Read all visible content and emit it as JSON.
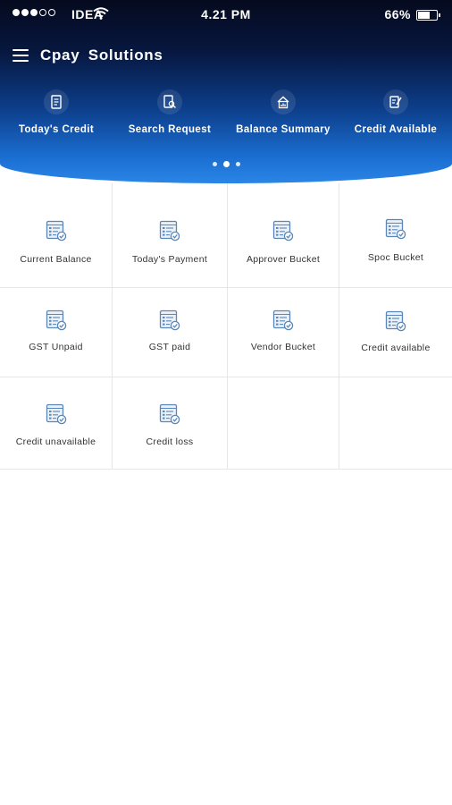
{
  "status_bar": {
    "carrier": "IDEA",
    "time": "4.21 PM",
    "battery_percent": "66%",
    "battery_level": 0.66
  },
  "app_bar": {
    "title": "Cpay  Solutions"
  },
  "quick_actions": [
    {
      "label": "Today's Credit",
      "icon": "document-icon"
    },
    {
      "label": "Search Request",
      "icon": "search-document-icon"
    },
    {
      "label": "Balance Summary",
      "icon": "home-chart-icon"
    },
    {
      "label": "Credit Available",
      "icon": "document-pen-icon"
    }
  ],
  "pager": {
    "pages": 3,
    "active": 1
  },
  "tiles": [
    {
      "label": "Current Balance"
    },
    {
      "label": "Today's Payment"
    },
    {
      "label": "Approver Bucket"
    },
    {
      "label": "Spoc Bucket"
    },
    {
      "label": "GST Unpaid"
    },
    {
      "label": "GST paid"
    },
    {
      "label": "Vendor Bucket"
    },
    {
      "label": "Credit available"
    },
    {
      "label": "Credit unavailable"
    },
    {
      "label": "Credit loss"
    }
  ],
  "colors": {
    "header_top": "#050a1e",
    "header_bottom": "#2a86e6",
    "icon_accent": "#5a87b8",
    "grid_line": "#e6e6e6"
  }
}
